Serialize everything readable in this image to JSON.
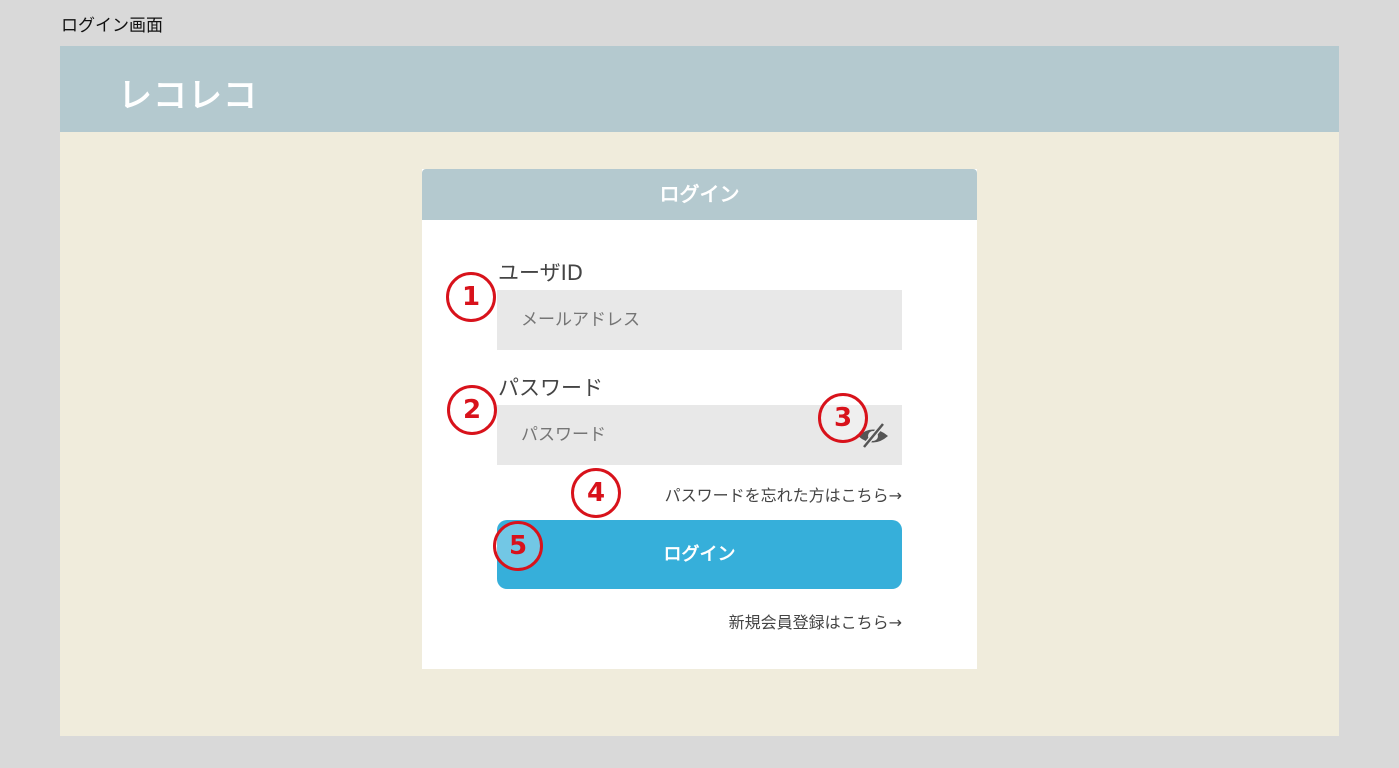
{
  "page_title": "ログイン画面",
  "app": {
    "logo": "レコレコ"
  },
  "login_card": {
    "title": "ログイン",
    "user_id_label": "ユーザID",
    "user_id_placeholder": "メールアドレス",
    "password_label": "パスワード",
    "password_placeholder": "パスワード",
    "password_toggle_icon": "eye-slash-icon",
    "forgot_password_link": "パスワードを忘れた方はこちら→",
    "login_button": "ログイン",
    "register_link": "新規会員登録はこちら→"
  },
  "annotations": [
    "1",
    "2",
    "3",
    "4",
    "5"
  ],
  "colors": {
    "header": "#b4c9cf",
    "background": "#f0ecdc",
    "button": "#36afda",
    "annotation": "#d8121b"
  }
}
